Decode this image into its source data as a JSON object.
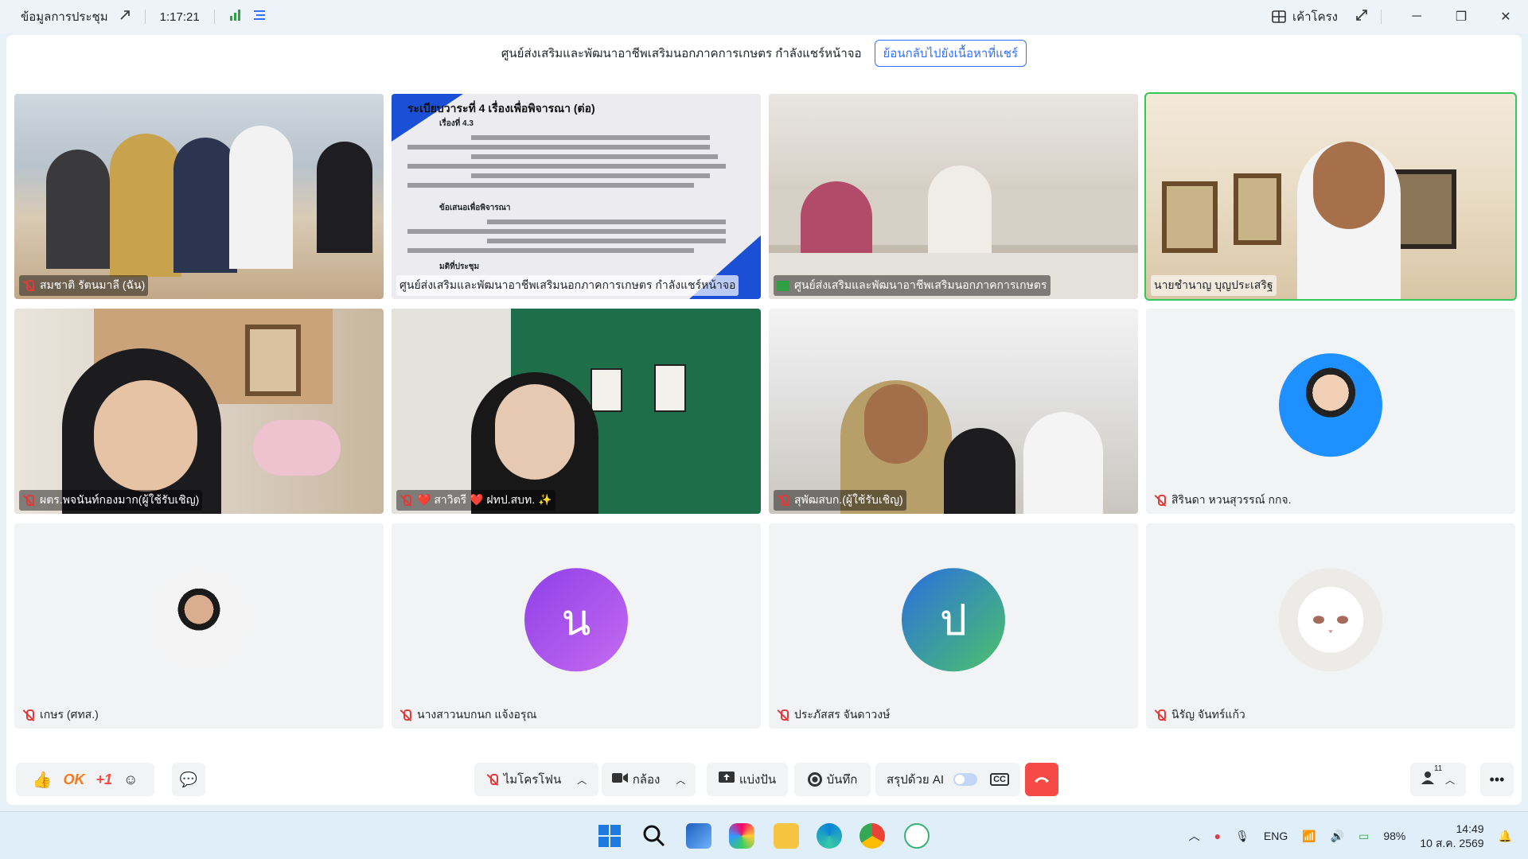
{
  "titlebar": {
    "meeting_info": "ข้อมูลการประชุม",
    "duration": "1:17:21",
    "layout_label": "เค้าโครง"
  },
  "share_banner": {
    "text": "ศูนย์ส่งเสริมและพัฒนาอาชีพเสริมนอกภาคการเกษตร กำลังแชร์หน้าจอ",
    "back_button": "ย้อนกลับไปยังเนื้อหาที่แชร์"
  },
  "slide": {
    "title": "ระเบียบวาระที่ 4 เรื่องเพื่อพิจารณา (ต่อ)",
    "item": "เรื่องที่ 4.3",
    "proposal_heading": "ข้อเสนอเพื่อพิจารณา",
    "resolution": "มติที่ประชุม"
  },
  "participants": [
    {
      "name": "สมชาติ รัตนมาลี (ฉัน)",
      "mic": "off"
    },
    {
      "name": "ศูนย์ส่งเสริมและพัฒนาอาชีพเสริมนอกภาคการเกษตร กำลังแชร์หน้าจอ",
      "mic": "none"
    },
    {
      "name": "ศูนย์ส่งเสริมและพัฒนาอาชีพเสริมนอกภาคการเกษตร",
      "mic": "sharing"
    },
    {
      "name": "นายชำนาญ บุญประเสริฐ",
      "mic": "on"
    },
    {
      "name": "ผตร.พจนันท์กองมาก(ผู้ใช้รับเชิญ)",
      "mic": "off"
    },
    {
      "name": "❤️ สาวิตรี ❤️ ฝทป.สบท. ✨",
      "mic": "off"
    },
    {
      "name": "สุพัฒสบก.(ผู้ใช้รับเชิญ)",
      "mic": "off"
    },
    {
      "name": "สิรินดา หวนสุวรรณ์ กกจ.",
      "mic": "off"
    },
    {
      "name": "เกษร (ศทส.)",
      "mic": "off"
    },
    {
      "name": "นางสาวนบกนก แจ้งอรุณ",
      "mic": "off",
      "initial": "น"
    },
    {
      "name": "ประภัสสร จันดาวงษ์",
      "mic": "off",
      "initial": "ป"
    },
    {
      "name": "นิรัญ จันทร์แก้ว",
      "mic": "off"
    }
  ],
  "toolbar": {
    "reaction_ok": "OK",
    "reaction_plus": "+1",
    "mic_label": "ไมโครโฟน",
    "camera_label": "กล้อง",
    "share_label": "แบ่งปัน",
    "record_label": "บันทึก",
    "ai_label": "สรุปด้วย AI",
    "cc_label": "CC",
    "participants_count": "11"
  },
  "taskbar": {
    "lang": "ENG",
    "battery": "98%",
    "time": "14:49",
    "date": "10 ส.ค. 2569"
  },
  "colors": {
    "accent": "#3370ff",
    "end_call": "#f54a45",
    "active_speaker": "#34c759",
    "muted": "#e03b3b"
  }
}
